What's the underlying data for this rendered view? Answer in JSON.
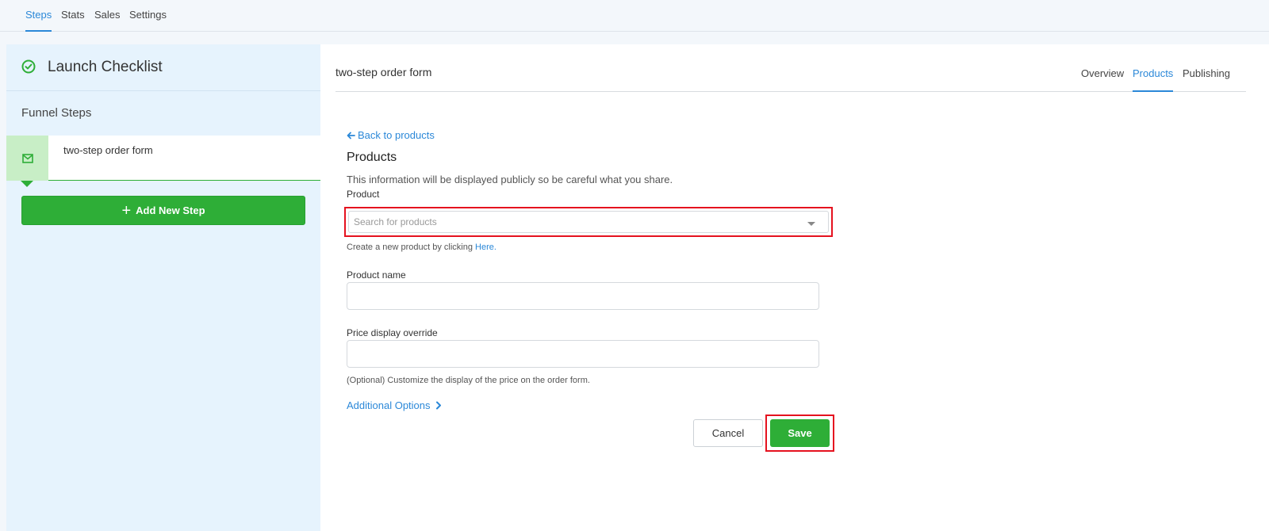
{
  "topnav": {
    "tabs": [
      {
        "label": "Steps",
        "active": true
      },
      {
        "label": "Stats",
        "active": false
      },
      {
        "label": "Sales",
        "active": false
      },
      {
        "label": "Settings",
        "active": false
      }
    ]
  },
  "sidebar": {
    "title": "Launch Checklist",
    "section_label": "Funnel Steps",
    "steps": [
      {
        "label": "two-step order form",
        "icon": "envelope-icon",
        "active": true
      }
    ],
    "add_button_label": "Add New Step"
  },
  "main": {
    "page_name": "two-step order form",
    "tabs": [
      {
        "label": "Overview",
        "active": false
      },
      {
        "label": "Products",
        "active": true
      },
      {
        "label": "Publishing",
        "active": false
      }
    ],
    "back_link": "Back to products",
    "section_title": "Products",
    "section_description": "This information will be displayed publicly so be careful what you share.",
    "product_field": {
      "label": "Product",
      "placeholder": "Search for products",
      "value": ""
    },
    "create_help_prefix": "Create a new product by clicking ",
    "create_help_link": "Here.",
    "product_name_field": {
      "label": "Product name",
      "value": ""
    },
    "price_field": {
      "label": "Price display override",
      "value": ""
    },
    "price_help": "(Optional) Customize the display of the price on the order form.",
    "additional_options": "Additional Options",
    "cancel_label": "Cancel",
    "save_label": "Save"
  },
  "colors": {
    "accent_blue": "#2b88d8",
    "primary_green": "#2eae37",
    "highlight_red": "#e5121f"
  }
}
